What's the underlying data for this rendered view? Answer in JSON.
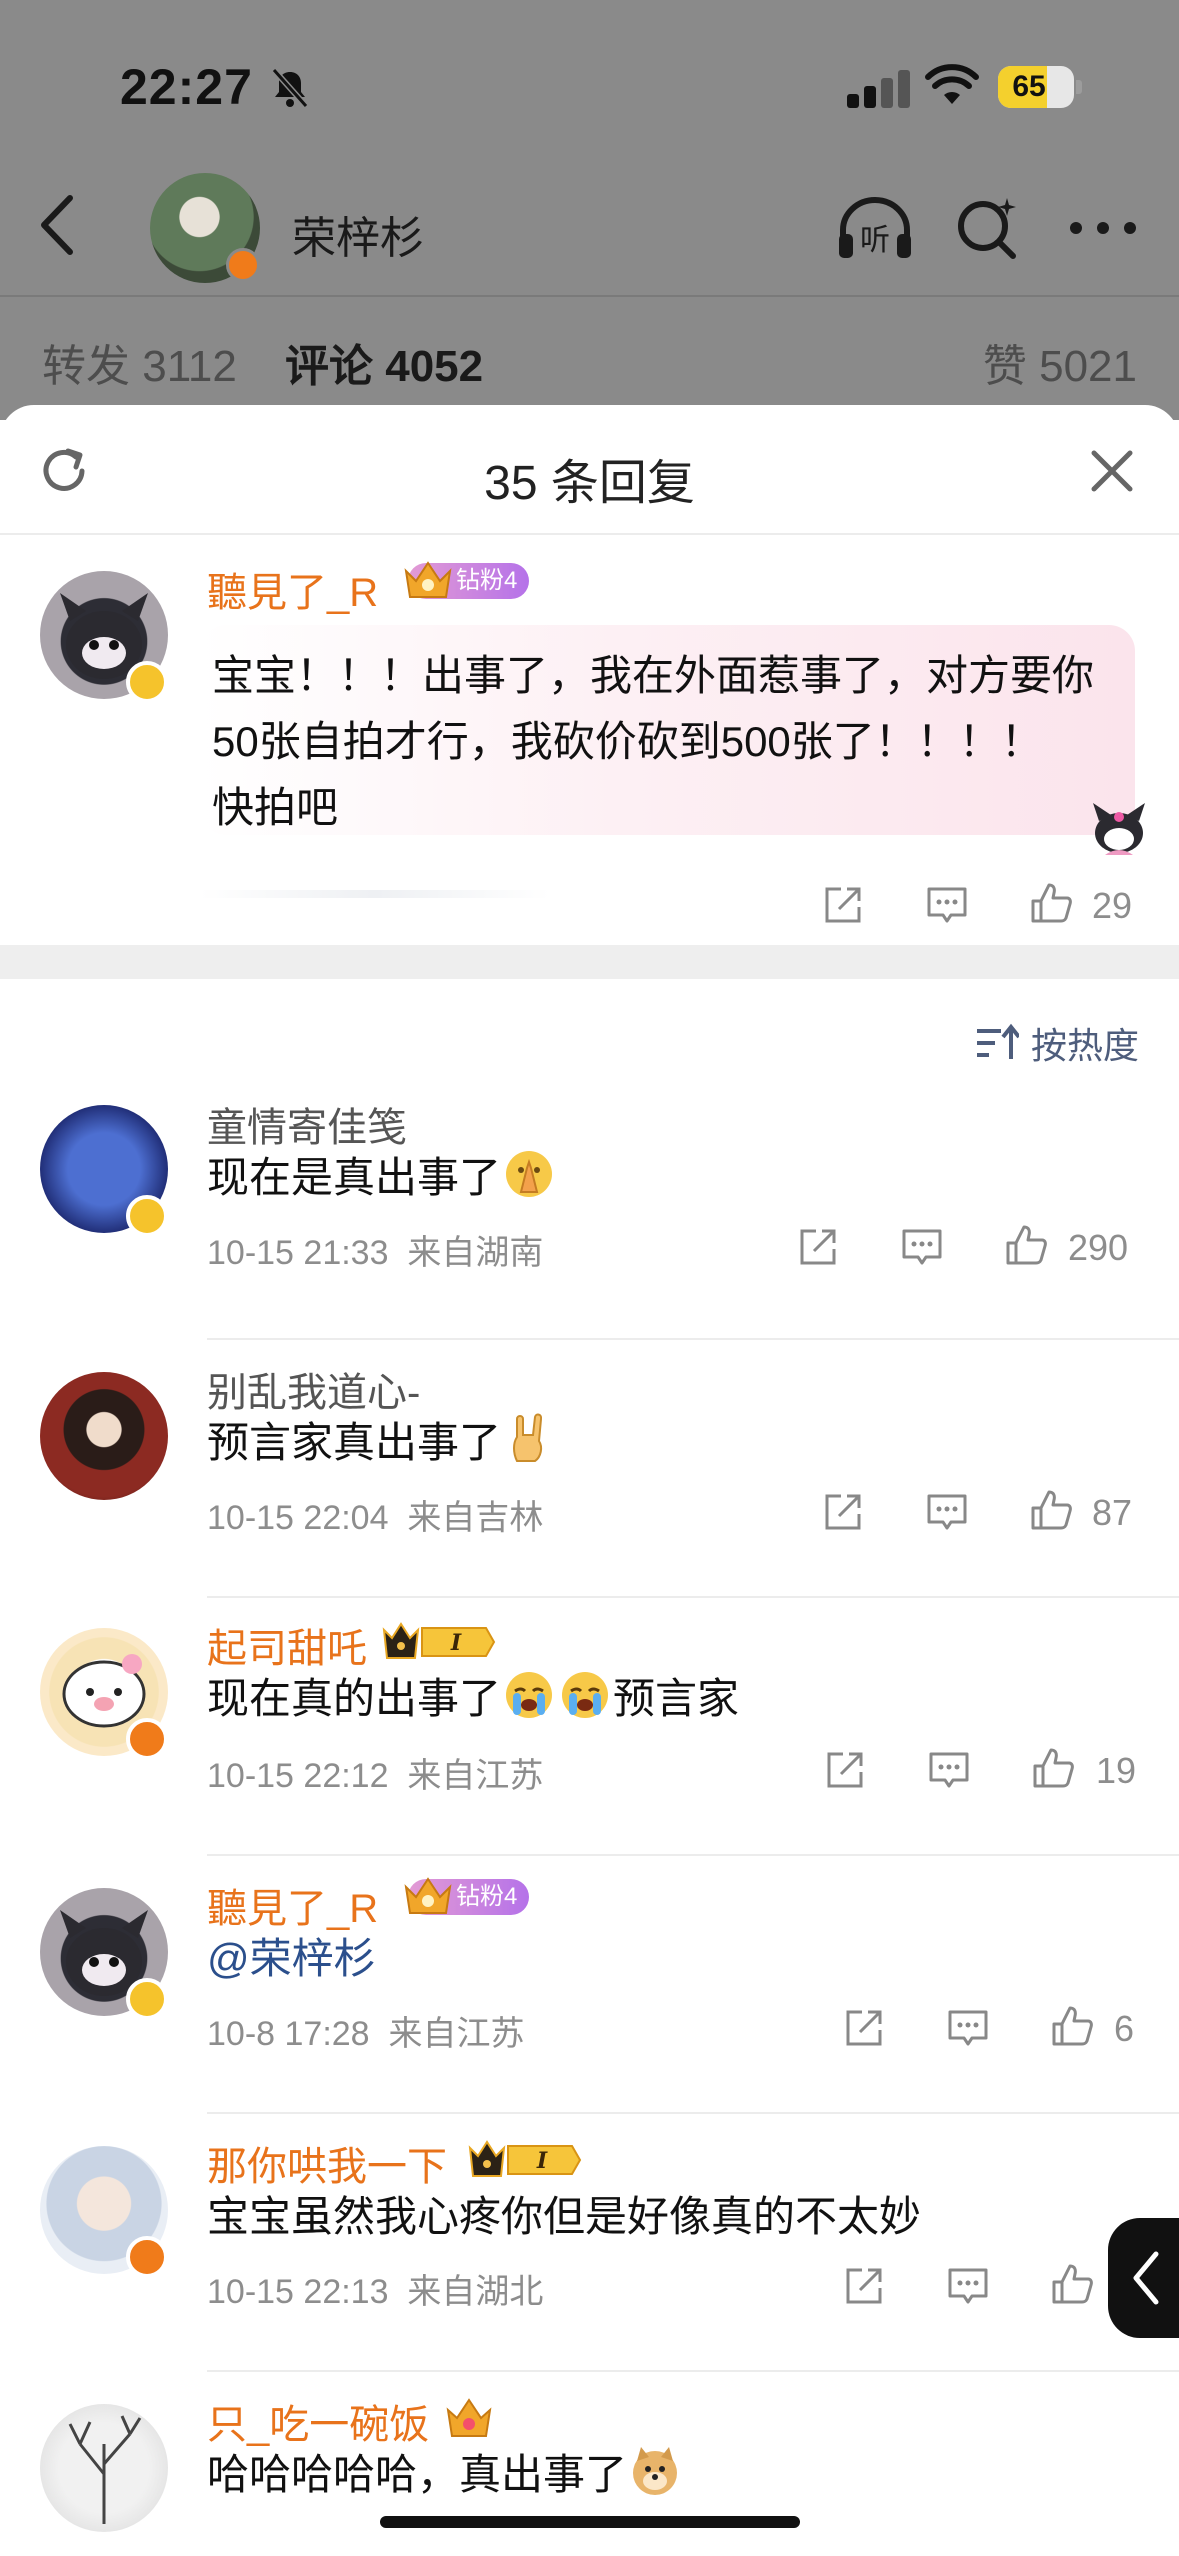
{
  "status_bar": {
    "time": "22:27",
    "battery": "65",
    "battery_level": 0.65
  },
  "profile": {
    "name": "荣梓杉"
  },
  "nav_icons": {
    "listen_label": "听"
  },
  "stats": {
    "repost": "转发 3112",
    "comment": "评论 4052",
    "like": "赞 5021"
  },
  "sheet": {
    "title": "35 条回复"
  },
  "root_comment": {
    "username": "聽見了_R",
    "badge": "钻粉4",
    "lines": [
      "宝宝！！！出事了，我在外面惹事了，对方要你",
      "50张自拍才行，我砍价砍到500张了！！！！",
      "快拍吧"
    ],
    "likes": "29"
  },
  "sort": {
    "label": "按热度"
  },
  "comments": [
    {
      "username": "童情寄佳笺",
      "text": "现在是真出事了",
      "time": "10-15 21:33",
      "location": "来自湖南",
      "likes": "290"
    },
    {
      "username": "别乱我道心-",
      "text": "预言家真出事了",
      "time": "10-15 22:04",
      "location": "来自吉林",
      "likes": "87"
    },
    {
      "username": "起司甜吒",
      "text_a": "现在真的出事了",
      "text_b": "预言家",
      "time": "10-15 22:12",
      "location": "来自江苏",
      "likes": "19",
      "vip_level": "I"
    },
    {
      "username": "聽見了_R",
      "badge": "钻粉4",
      "text": "@荣梓杉",
      "time": "10-8 17:28",
      "location": "来自江苏",
      "likes": "6"
    },
    {
      "username": "那你哄我一下",
      "text": "宝宝虽然我心疼你但是好像真的不太妙",
      "time": "10-15 22:13",
      "location": "来自湖北",
      "vip_level": "I"
    },
    {
      "username": "只_吃一碗饭",
      "text": "哈哈哈哈哈，真出事了"
    }
  ],
  "colors": {
    "orange_name": "#e8731b",
    "fan_badge": "#b572e9",
    "sort_link": "#4e5d7c",
    "verified_gold": "#f5c32c"
  }
}
